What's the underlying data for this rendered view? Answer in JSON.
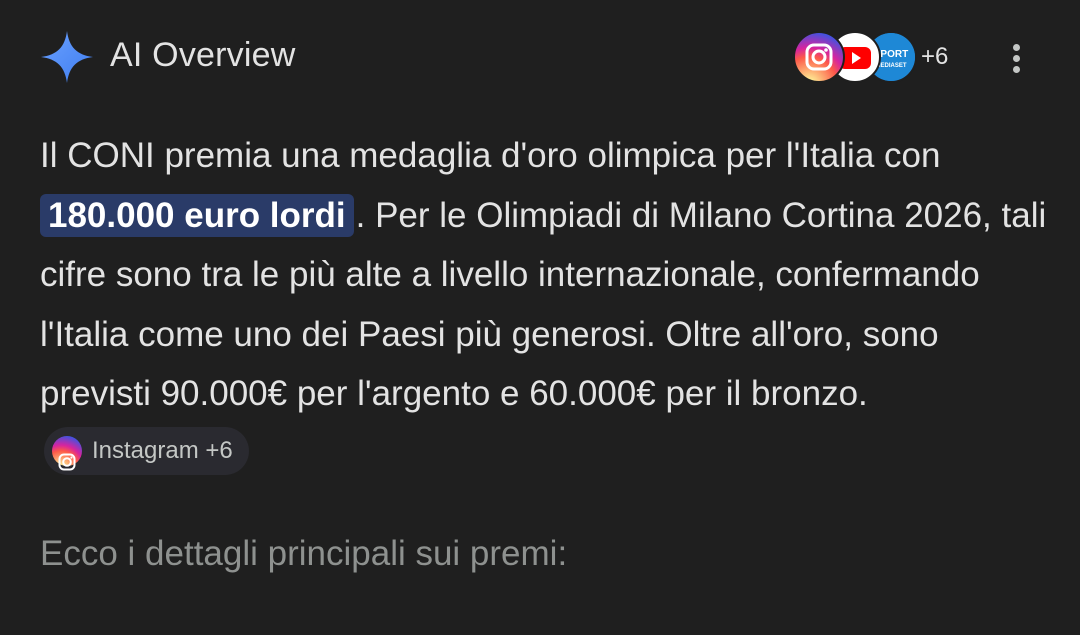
{
  "header": {
    "title": "AI Overview",
    "sparkle_icon": "gemini-sparkle-icon",
    "sources": {
      "icons": [
        "instagram-icon",
        "youtube-icon",
        "sportmediaset-icon"
      ],
      "sportmediaset_text": "SPORT MEDIASET",
      "more_count": "+6"
    },
    "menu_icon": "more-vertical-icon"
  },
  "body": {
    "text_before": "Il CONI premia una medaglia d'oro olimpica per l'Italia con ",
    "highlight": "180.000 euro lordi",
    "text_after": ". Per le Olimpiadi di Milano Cortina 2026, tali cifre sono tra le più alte a livello internazionale, confermando l'Italia come uno dei Paesi più generosi. Oltre all'oro, sono previsti 90.000€ per l'argento e 60.000€ per il bronzo. ",
    "citation_chip": {
      "icon": "instagram-icon",
      "label": "Instagram +6"
    },
    "secondary": "Ecco i dettagli principali sui premi:"
  },
  "colors": {
    "background": "#1f1f1f",
    "text": "#e3e3e3",
    "highlight_bg": "#2a3b68",
    "secondary_text": "#8e918f",
    "sparkle_blue": "#4e8df5"
  }
}
